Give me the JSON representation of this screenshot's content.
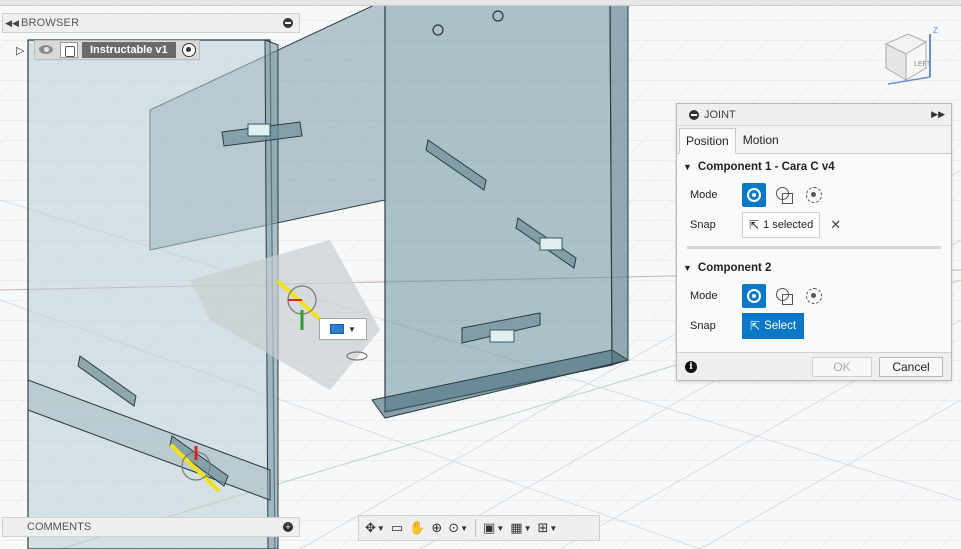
{
  "browser": {
    "header_label": "BROWSER",
    "root_name": "Instructable v1"
  },
  "comments": {
    "label": "COMMENTS"
  },
  "viewcube": {
    "face_label": "LEFT",
    "axis_label": "Z"
  },
  "joint_dialog": {
    "title": "JOINT",
    "tabs": [
      "Position",
      "Motion"
    ],
    "component1": {
      "heading": "Component 1 - Cara C v4",
      "mode_label": "Mode",
      "snap_label": "Snap",
      "snap_value": "1 selected"
    },
    "component2": {
      "heading": "Component 2",
      "mode_label": "Mode",
      "snap_label": "Snap",
      "snap_value": "Select"
    },
    "ok_label": "OK",
    "cancel_label": "Cancel"
  },
  "colors": {
    "accent_blue": "#0a78c8",
    "panel_glass": "#5f8a99",
    "highlight_yellow": "#f2e21b"
  }
}
